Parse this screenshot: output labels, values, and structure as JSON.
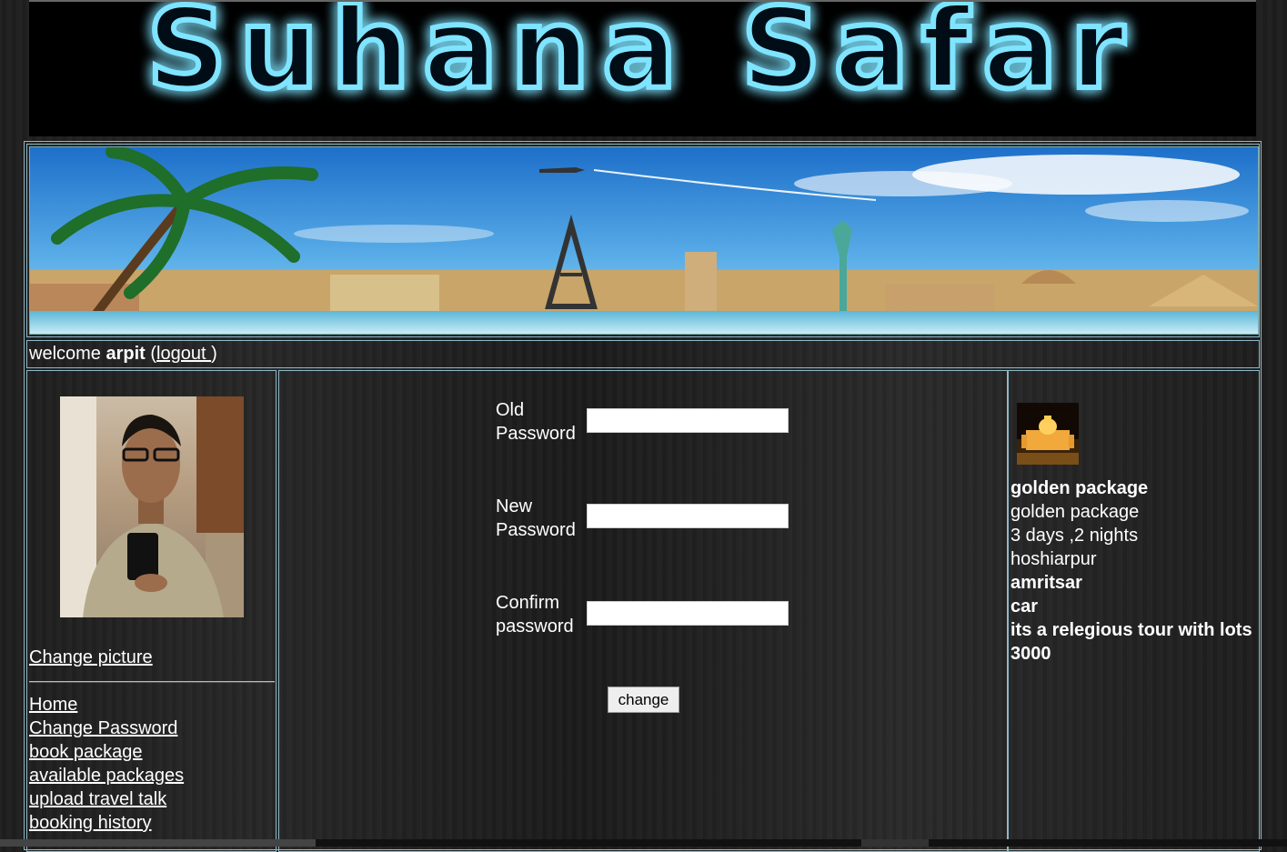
{
  "header": {
    "logo_text": "Suhana Safar"
  },
  "welcome": {
    "prefix": "welcome ",
    "username": "arpit",
    "open_paren": " (",
    "logout_label": "logout ",
    "close_paren": ")"
  },
  "sidebar": {
    "change_picture": "Change picture",
    "nav": [
      "Home ",
      "Change Password",
      "book package ",
      "available packages",
      "upload travel talk",
      "booking history"
    ]
  },
  "form": {
    "old_password_label": "Old Password",
    "new_password_label": "New Password",
    "confirm_password_label": "Confirm password",
    "old_password_value": "",
    "new_password_value": "",
    "confirm_password_value": "",
    "submit_label": "change"
  },
  "package": {
    "title": "golden package",
    "name": "golden package",
    "duration": "3 days ,2 nights",
    "from": "hoshiarpur",
    "to": "amritsar",
    "transport": "car",
    "description": "its a relegious tour with lots",
    "price": "3000"
  },
  "colors": {
    "border": "#8fb8c8",
    "logo_glow": "#22c8ff",
    "sky": "#2a86d6"
  }
}
